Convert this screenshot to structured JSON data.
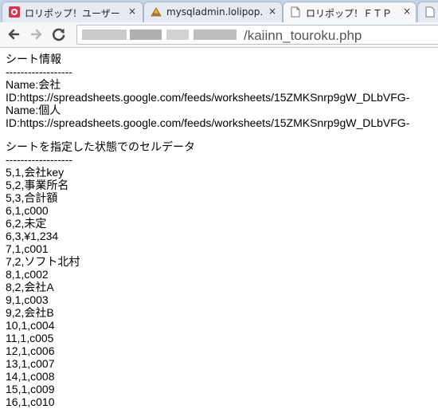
{
  "tabs": [
    {
      "title": "ロリポップ！ユーザー",
      "icon": "lolipop-favicon-icon",
      "close": "×"
    },
    {
      "title": "mysqladmin.lolipop.",
      "icon": "phpmyadmin-favicon-icon",
      "close": "×"
    },
    {
      "title": "ロリポップ！ＦＴＰ",
      "icon": "document-icon",
      "close": "×"
    }
  ],
  "toolbar": {
    "back": "back-arrow-icon",
    "forward": "forward-arrow-icon",
    "reload": "reload-icon",
    "url_path": "/kaiinn_touroku.php"
  },
  "content": {
    "sheet_info_heading": "シート情報",
    "separator": "------------------",
    "sheets": [
      {
        "name": "Name:会社",
        "id": "ID:https://spreadsheets.google.com/feeds/worksheets/15ZMKSnrp9gW_DLbVFG-"
      },
      {
        "name": "Name:個人",
        "id": "ID:https://spreadsheets.google.com/feeds/worksheets/15ZMKSnrp9gW_DLbVFG-"
      }
    ],
    "cell_data_heading": "シートを指定した状態でのセルデータ",
    "separator2": "------------------",
    "cells": [
      "5,1,会社key",
      "5,2,事業所名",
      "5,3,合計額",
      "6,1,c000",
      "6,2,未定",
      "6,3,¥1,234",
      "7,1,c001",
      "7,2,ソフト北村",
      "8,1,c002",
      "8,2,会社A",
      "9,1,c003",
      "9,2,会社B",
      "10,1,c004",
      "11,1,c005",
      "12,1,c006",
      "13,1,c007",
      "14,1,c008",
      "15,1,c009",
      "16,1,c010"
    ]
  }
}
